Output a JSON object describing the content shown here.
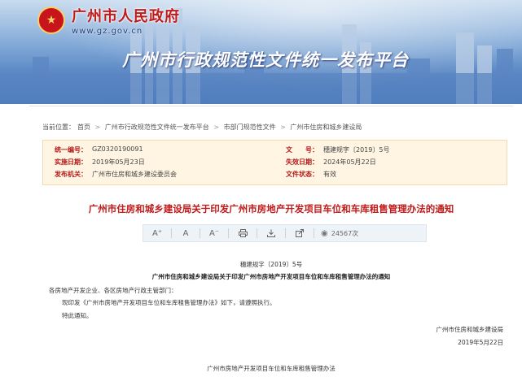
{
  "header": {
    "site_name": "广州市人民政府",
    "site_url": "www.gz.gov.cn",
    "platform_title": "广州市行政规范性文件统一发布平台"
  },
  "breadcrumb": {
    "prefix": "当前位置：",
    "items": [
      "首页",
      "广州市行政规范性文件统一发布平台",
      "市部门规范性文件",
      "广州市住房和城乡建设局"
    ],
    "separator": ">"
  },
  "meta": {
    "unified_number_label": "统一编号：",
    "unified_number": "GZ0320190091",
    "doc_number_label": "文　　号：",
    "doc_number": "穗建规字〔2019〕5号",
    "effective_date_label": "实施日期：",
    "effective_date": "2019年05月23日",
    "expiry_date_label": "失效日期：",
    "expiry_date": "2024年05月22日",
    "issuer_label": "发布机关：",
    "issuer": "广州市住房和城乡建设委员会",
    "status_label": "文件状态：",
    "status": "有效"
  },
  "document": {
    "title": "广州市住房和城乡建设局关于印发广州市房地产开发项目车位和车库租售管理办法的通知",
    "number": "穗建规字〔2019〕5号",
    "inner_title": "广州市住房和城乡建设局关于印发广州市房地产开发项目车位和车库租售管理办法的通知",
    "recipients": "各房地产开发企业、各区房地产行政主管部门：",
    "body": "现印发《广州市房地产开发项目车位和车库租售管理办法》如下，请遵照执行。",
    "closing": "特此通知。",
    "signature": "广州市住房和城乡建设局",
    "date": "2019年5月22日",
    "attachment_title": "广州市房地产开发项目车位和车库租售管理办法"
  },
  "toolbar": {
    "font_increase": "A⁺",
    "font_default": "A",
    "font_decrease": "A⁻",
    "views": "24567次"
  },
  "icons": {
    "emblem": "national-emblem-icon",
    "print": "print-icon",
    "download": "download-icon",
    "share": "share-icon",
    "views": "eye-icon"
  },
  "colors": {
    "accent_red": "#c01a1a",
    "meta_background": "#fff5e2",
    "banner_blue": "#2f63b0"
  }
}
